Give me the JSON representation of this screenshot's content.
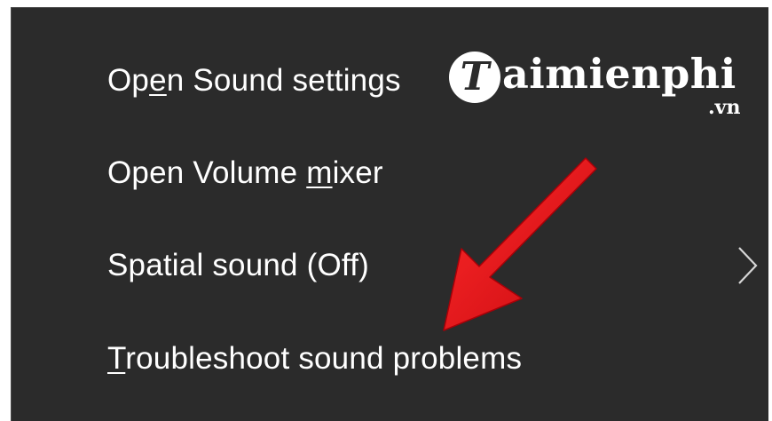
{
  "menu": {
    "items": [
      {
        "before": "Op",
        "mnemonic": "e",
        "after": "n Sound settings"
      },
      {
        "before": "Open Volume ",
        "mnemonic": "m",
        "after": "ixer"
      },
      {
        "before": "Spatial sound (Off)",
        "mnemonic": "",
        "after": ""
      },
      {
        "before": "",
        "mnemonic": "T",
        "after": "roubleshoot sound problems"
      }
    ],
    "submenu_icon": "chevron-right-icon"
  },
  "watermark": {
    "letter": "T",
    "word": "aimienphi",
    "tld": ".vn"
  },
  "annotation": {
    "icon": "red-arrow-icon",
    "color": "#e8141b"
  }
}
